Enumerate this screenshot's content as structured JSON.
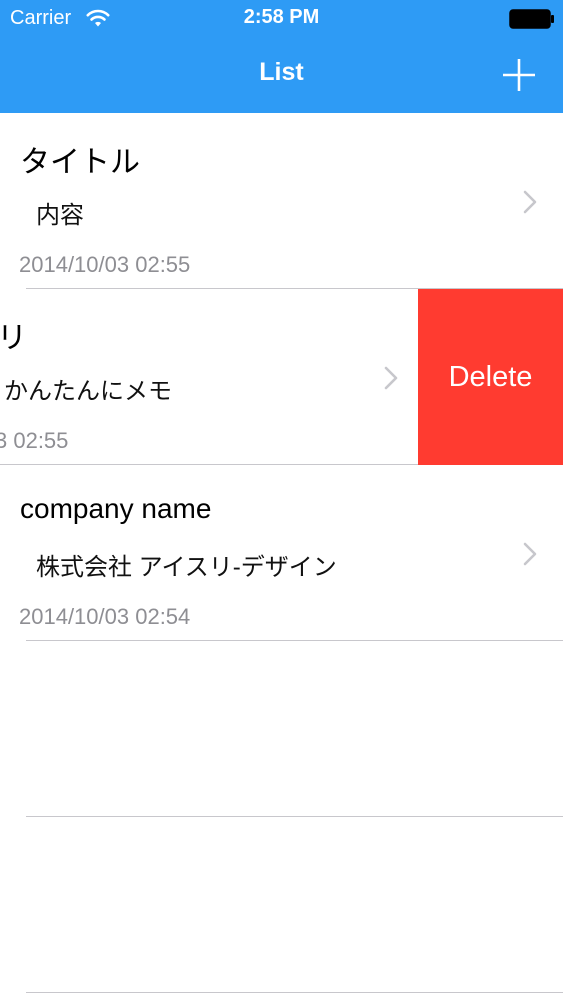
{
  "status_bar": {
    "carrier": "Carrier",
    "time": "2:58 PM",
    "wifi_icon": "wifi-icon",
    "battery_icon": "battery-icon"
  },
  "nav_bar": {
    "title": "List",
    "add_icon": "plus-icon",
    "background_color": "#2e9bf5"
  },
  "list": {
    "rows": [
      {
        "title": "タイトル",
        "body": "内容",
        "date": "2014/10/03 02:55"
      },
      {
        "title": "リ",
        "body": "かんたんにメモ",
        "date": "3 02:55",
        "swiped": true,
        "delete_label": "Delete",
        "delete_color": "#ff3b30"
      },
      {
        "title": "company name",
        "body": "株式会社 アイスリ-デザイン",
        "date": "2014/10/03 02:54"
      }
    ]
  }
}
